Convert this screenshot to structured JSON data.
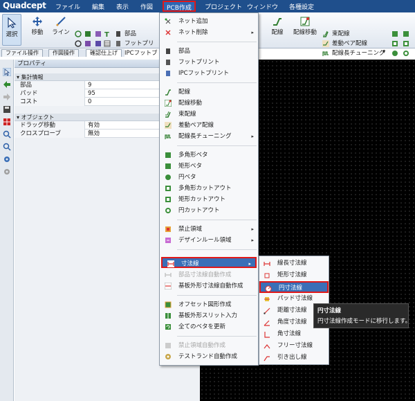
{
  "app": {
    "logo": "Quadcept"
  },
  "menubar": {
    "items": [
      "ファイル",
      "編集",
      "表示",
      "作図",
      "PCB作成",
      "プロジェクト",
      "ウィンドウ",
      "各種設定"
    ],
    "active": "PCB作成"
  },
  "ribbon": {
    "select": "選択",
    "move": "移動",
    "line": "ライン",
    "part": "部品",
    "footprint": "フットプリ",
    "ipc_footprint": "IPCフットブ",
    "route": "配線",
    "route_move": "配線移動",
    "bundle_route": "束配線",
    "diff_pair": "差動ペア配線",
    "length_tuning": "配線長チューニング",
    "dropdown_arrow": "▾"
  },
  "tabs": [
    "ファイル操作",
    "作図操作",
    "確認仕上げ"
  ],
  "properties": {
    "title": "プロパティ",
    "sections": [
      {
        "label": "集計情報",
        "rows": [
          {
            "key": "部品",
            "value": "9"
          },
          {
            "key": "パッド",
            "value": "95"
          },
          {
            "key": "コスト",
            "value": "0"
          }
        ]
      },
      {
        "label": "オブジェクト",
        "rows": [
          {
            "key": "ドラッグ移動",
            "value": "有効"
          },
          {
            "key": "クロスプローブ",
            "value": "無効"
          }
        ]
      }
    ]
  },
  "dropdown": {
    "items": [
      {
        "label": "ネット追加",
        "icon": "net-add-icon"
      },
      {
        "label": "ネット削除",
        "icon": "net-delete-icon",
        "submenu": true
      },
      {
        "label": "部品",
        "icon": "part-icon"
      },
      {
        "label": "フットプリント",
        "icon": "footprint-icon"
      },
      {
        "label": "IPCフットプリント",
        "icon": "ipc-footprint-icon"
      },
      {
        "label": "配線",
        "icon": "route-icon"
      },
      {
        "label": "配線移動",
        "icon": "route-move-icon"
      },
      {
        "label": "束配線",
        "icon": "bundle-route-icon"
      },
      {
        "label": "差動ペア配線",
        "icon": "diff-pair-icon"
      },
      {
        "label": "配線長チューニング",
        "icon": "length-tuning-icon",
        "submenu": true
      },
      {
        "label": "多角形ベタ",
        "icon": "polygon-fill-icon"
      },
      {
        "label": "矩形ベタ",
        "icon": "rect-fill-icon"
      },
      {
        "label": "円ベタ",
        "icon": "circle-fill-icon"
      },
      {
        "label": "多角形カットアウト",
        "icon": "polygon-cutout-icon"
      },
      {
        "label": "矩形カットアウト",
        "icon": "rect-cutout-icon"
      },
      {
        "label": "円カットアウト",
        "icon": "circle-cutout-icon"
      },
      {
        "label": "禁止領域",
        "icon": "keepout-icon",
        "submenu": true
      },
      {
        "label": "デザインルール領域",
        "icon": "design-rule-area-icon",
        "submenu": true
      },
      {
        "label": "寸法線",
        "icon": "dimension-icon",
        "submenu": true,
        "highlighted": true
      },
      {
        "label": "部品寸法線自動作成",
        "icon": "auto-part-dimension-icon",
        "disabled": true
      },
      {
        "label": "基板外形寸法線自動作成",
        "icon": "board-outline-dimension-icon"
      },
      {
        "label": "オフセット図形作成",
        "icon": "offset-shape-icon"
      },
      {
        "label": "基板外形スリット入力",
        "icon": "board-slit-icon"
      },
      {
        "label": "全てのベタを更新",
        "icon": "refresh-fills-icon"
      },
      {
        "label": "禁止領域自動作成",
        "icon": "auto-keepout-icon",
        "disabled": true
      },
      {
        "label": "テストランド自動作成",
        "icon": "testland-icon"
      }
    ],
    "arrow": "▸"
  },
  "submenu": {
    "items": [
      {
        "label": "線長寸法線",
        "icon": "linear-dimension-icon"
      },
      {
        "label": "矩形寸法線",
        "icon": "rect-dimension-icon"
      },
      {
        "label": "円寸法線",
        "icon": "circle-dimension-icon",
        "highlighted": true
      },
      {
        "label": "パッド寸法線",
        "icon": "pad-dimension-icon"
      },
      {
        "label": "距離寸法線",
        "icon": "distance-dimension-icon"
      },
      {
        "label": "角度寸法線",
        "icon": "angle-dimension-icon"
      },
      {
        "label": "角寸法線",
        "icon": "corner-dimension-icon"
      },
      {
        "label": "フリー寸法線",
        "icon": "free-dimension-icon"
      },
      {
        "label": "引き出し線",
        "icon": "leader-line-icon"
      }
    ]
  },
  "tooltip": {
    "title": "円寸法線",
    "text": "円寸法線作成モードに移行します。"
  },
  "colors": {
    "menubar": "#1f4f8c",
    "highlight": "#3a6fb7",
    "outline": "#e01818",
    "canvas": "#000000"
  }
}
